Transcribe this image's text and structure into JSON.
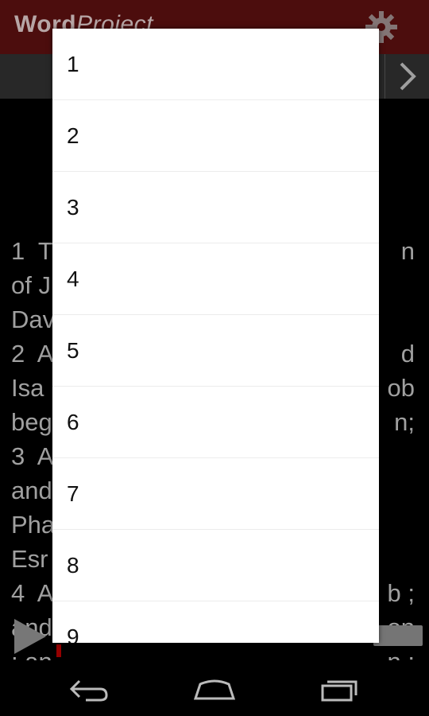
{
  "app": {
    "title_bold": "Word",
    "title_light": "Project",
    "settings_icon": "gear-icon"
  },
  "verses_partial": [
    {
      "left": "1  T",
      "right": "n"
    },
    {
      "left": "of J",
      "right": ""
    },
    {
      "left": "Dav",
      "right": ""
    },
    {
      "left": "2  A",
      "right": "d"
    },
    {
      "left": "Isa",
      "right": "ob"
    },
    {
      "left": "beg",
      "right": "n;"
    },
    {
      "left": "3  A",
      "right": ""
    },
    {
      "left": "and",
      "right": ""
    },
    {
      "left": "Pha",
      "right": ""
    },
    {
      "left": "Esr",
      "right": ""
    },
    {
      "left": "4  A",
      "right": "b ;"
    },
    {
      "left": "and",
      "right": "on"
    },
    {
      "left": "; an",
      "right": "n ;"
    }
  ],
  "dropdown": {
    "items": [
      "1",
      "2",
      "3",
      "4",
      "5",
      "6",
      "7",
      "8",
      "9"
    ]
  },
  "player": {
    "play_icon": "play-icon"
  },
  "system_nav": {
    "back_icon": "back-icon",
    "home_icon": "home-icon",
    "recents_icon": "recents-icon"
  }
}
